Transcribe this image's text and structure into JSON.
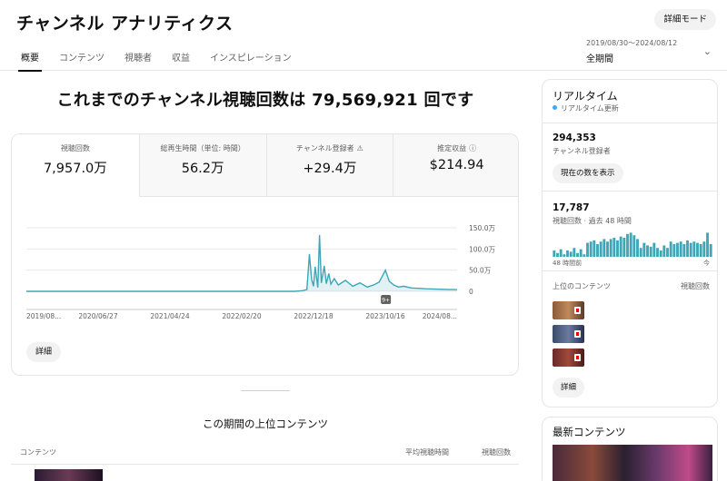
{
  "header": {
    "title": "チャンネル アナリティクス",
    "detail_mode": "詳細モード",
    "tabs": [
      "概要",
      "コンテンツ",
      "視聴者",
      "収益",
      "インスピレーション"
    ],
    "date_range": "2019/08/30～2024/08/12",
    "period": "全期間"
  },
  "overview": {
    "headline": "これまでのチャンネル視聴回数は 79,569,921 回です",
    "metrics": [
      {
        "label": "視聴回数",
        "value": "7,957.0万",
        "icon": ""
      },
      {
        "label": "総再生時間（単位: 時間）",
        "value": "56.2万",
        "icon": ""
      },
      {
        "label": "チャンネル登録者",
        "value": "+29.4万",
        "icon": "⚠"
      },
      {
        "label": "推定収益",
        "value": "$214.94",
        "icon": "ⓘ"
      }
    ],
    "detail_button": "詳細"
  },
  "chart_data": {
    "type": "area",
    "x_tick_labels": [
      "2019/08...",
      "2020/06/27",
      "2021/04/24",
      "2022/02/20",
      "2022/12/18",
      "2023/10/16",
      "2024/08..."
    ],
    "y_tick_labels": [
      "150.0万",
      "100.0万",
      "50.0万",
      "0"
    ],
    "ylim": [
      0,
      1500000
    ],
    "series": [
      {
        "color": "#3ea6b8",
        "x": [
          "2019/08/30",
          "2020/06/27",
          "2021/04/24",
          "2022/02/20",
          "2022/10/01",
          "2022/11/01",
          "2022/11/20",
          "2022/12/01",
          "2022/12/10",
          "2022/12/18",
          "2022/12/25",
          "2023/01/05",
          "2023/01/12",
          "2023/01/20",
          "2023/02/01",
          "2023/02/10",
          "2023/02/20",
          "2023/03/01",
          "2023/03/15",
          "2023/04/01",
          "2023/05/01",
          "2023/06/01",
          "2023/07/01",
          "2023/08/01",
          "2023/09/01",
          "2023/09/20",
          "2023/10/05",
          "2023/10/16",
          "2023/11/01",
          "2023/11/20",
          "2023/12/10",
          "2024/01/01",
          "2024/02/01",
          "2024/03/01",
          "2024/04/01",
          "2024/05/01",
          "2024/06/01",
          "2024/07/01",
          "2024/08/12"
        ],
        "y": [
          0,
          0,
          0,
          0,
          0,
          15000,
          40000,
          880000,
          280000,
          120000,
          580000,
          90000,
          1330000,
          200000,
          600000,
          180000,
          420000,
          170000,
          300000,
          150000,
          260000,
          120000,
          200000,
          100000,
          160000,
          220000,
          380000,
          500000,
          240000,
          150000,
          100000,
          120000,
          80000,
          70000,
          60000,
          55000,
          50000,
          45000,
          40000
        ]
      }
    ],
    "annotation": "9+"
  },
  "top_content": {
    "title": "この期間の上位コンテンツ",
    "col_content": "コンテンツ",
    "col_avg": "平均視聴時間",
    "col_views": "視聴回数"
  },
  "realtime": {
    "title": "リアルタイム",
    "subtitle": "リアルタイム更新",
    "subscribers": "294,353",
    "subscribers_label": "チャンネル登録者",
    "show_count_button": "現在の数を表示",
    "views": "17,787",
    "views_label": "視聴回数 · 過去 48 時間",
    "bars": [
      0.25,
      0.15,
      0.3,
      0.1,
      0.25,
      0.2,
      0.35,
      0.15,
      0.3,
      0.1,
      0.55,
      0.6,
      0.65,
      0.5,
      0.6,
      0.7,
      0.6,
      0.7,
      0.75,
      0.65,
      0.8,
      0.75,
      0.9,
      0.95,
      0.85,
      0.7,
      0.35,
      0.55,
      0.45,
      0.4,
      0.55,
      0.35,
      0.25,
      0.45,
      0.35,
      0.6,
      0.5,
      0.55,
      0.6,
      0.5,
      0.65,
      0.55,
      0.6,
      0.55,
      0.5,
      0.6,
      0.95,
      0.5
    ],
    "axis_left": "48 時間前",
    "axis_right": "今",
    "top_label": "上位のコンテンツ",
    "top_views_label": "視聴回数",
    "detail_button": "詳細"
  },
  "latest": {
    "title": "最新コンテンツ"
  }
}
